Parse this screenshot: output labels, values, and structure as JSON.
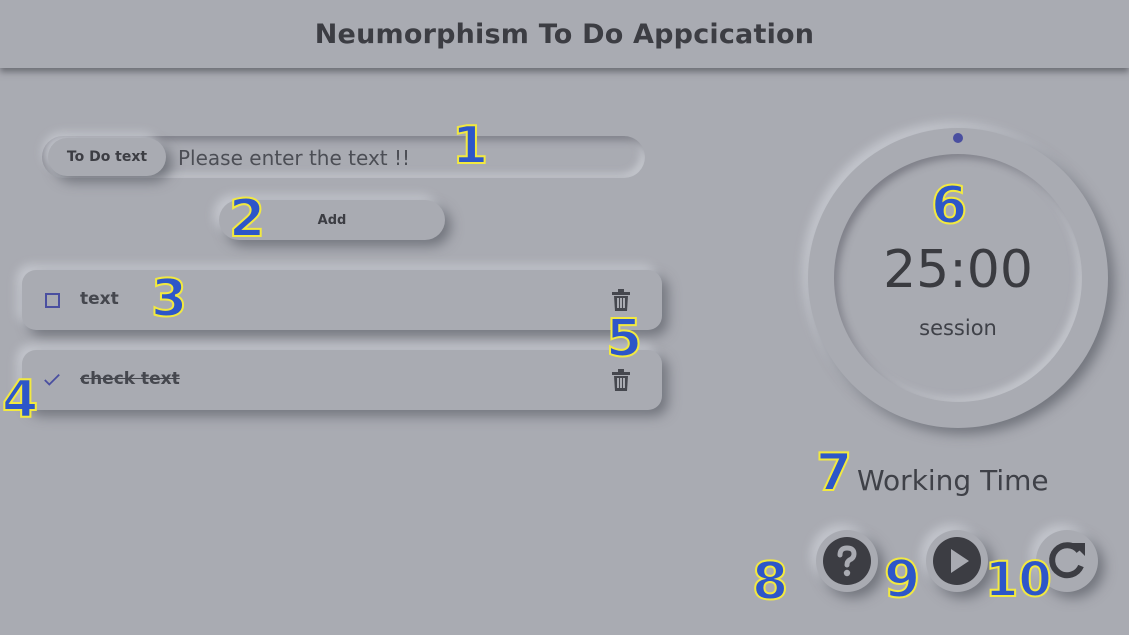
{
  "header": {
    "title": "Neumorphism To Do Appcication"
  },
  "input": {
    "label": "To Do text",
    "placeholder": "Please enter the text !!",
    "value": ""
  },
  "add_button": {
    "label": "Add"
  },
  "todos": [
    {
      "text": "text",
      "checked": false
    },
    {
      "text": "check text",
      "checked": true
    }
  ],
  "timer": {
    "time": "25:00",
    "label": "session",
    "mode": "Working Time"
  },
  "controls": {
    "help_icon": "question-circle-icon",
    "play_icon": "play-circle-icon",
    "reset_icon": "redo-icon"
  },
  "markers": [
    "1",
    "2",
    "3",
    "4",
    "5",
    "6",
    "7",
    "8",
    "9",
    "10"
  ],
  "colors": {
    "background": "#a9abb2",
    "accent": "#4a4fa0",
    "marker_fill": "#2d56c9",
    "marker_outline": "#f2e940"
  }
}
